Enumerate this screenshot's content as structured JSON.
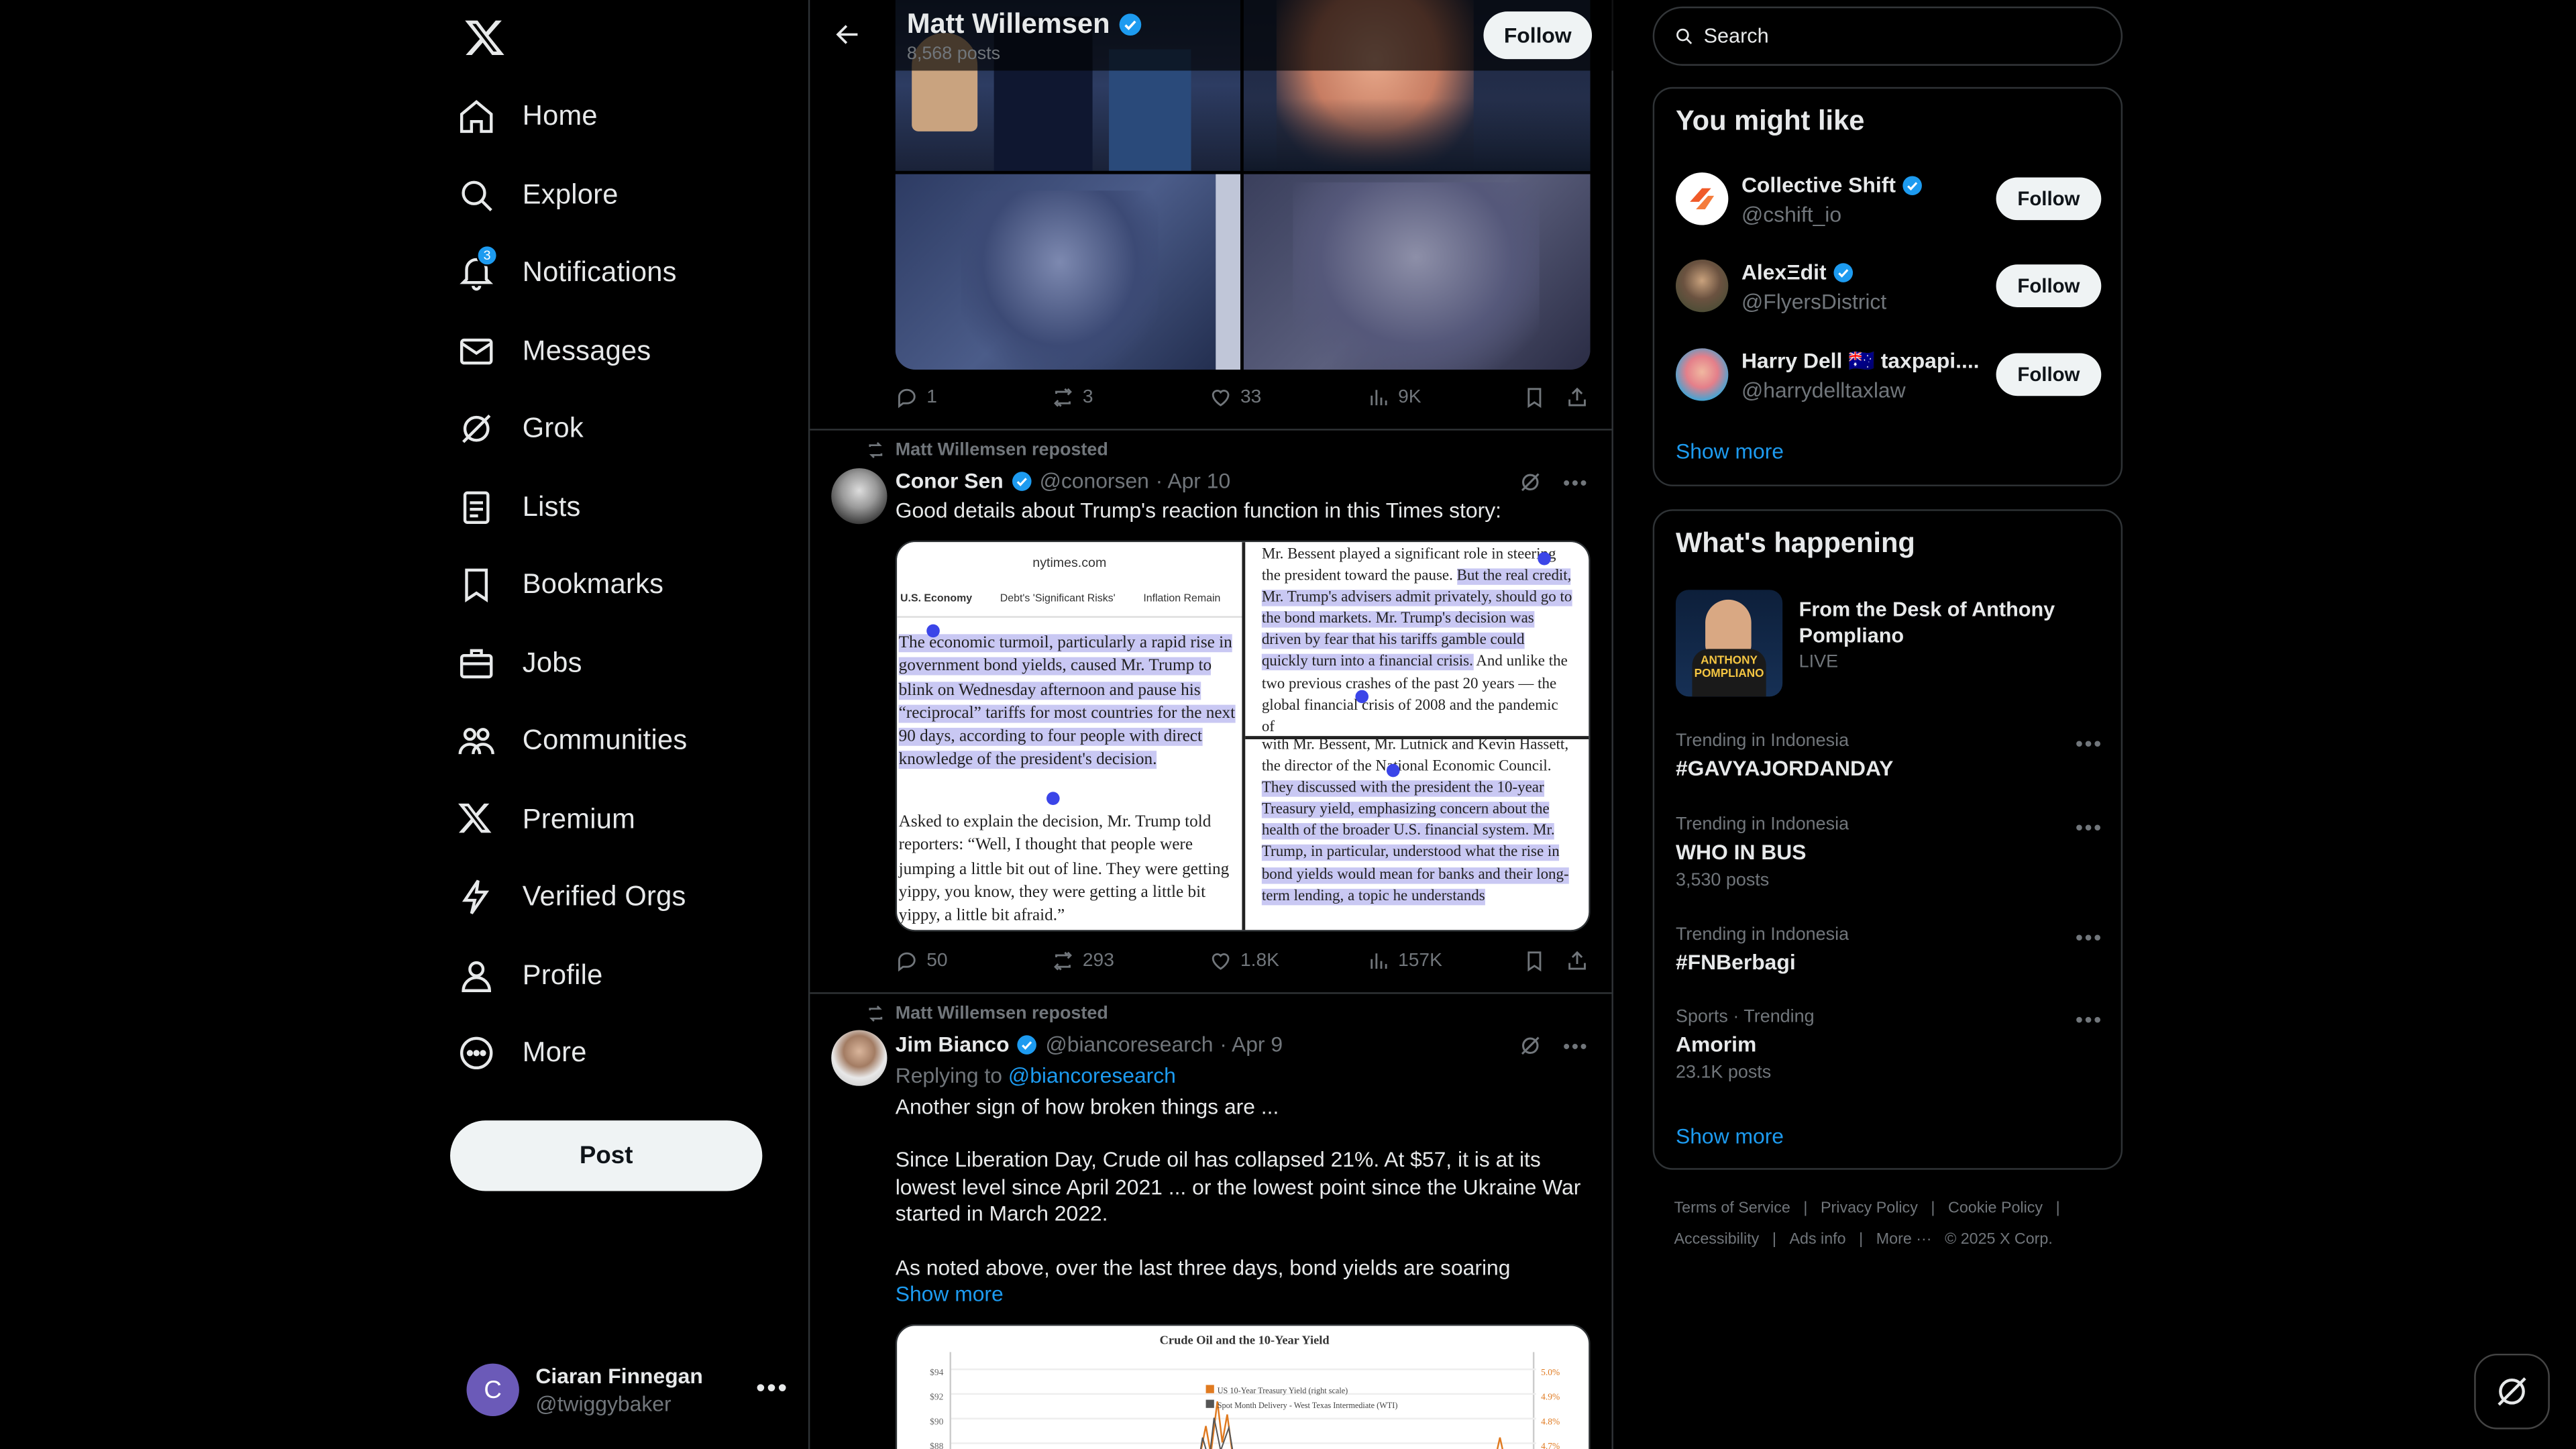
{
  "nav": {
    "items": [
      {
        "label": "Home",
        "icon": "home-icon"
      },
      {
        "label": "Explore",
        "icon": "search-icon"
      },
      {
        "label": "Notifications",
        "icon": "bell-icon",
        "badge": "3"
      },
      {
        "label": "Messages",
        "icon": "envelope-icon"
      },
      {
        "label": "Grok",
        "icon": "grok-icon"
      },
      {
        "label": "Lists",
        "icon": "list-icon"
      },
      {
        "label": "Bookmarks",
        "icon": "bookmark-icon"
      },
      {
        "label": "Jobs",
        "icon": "briefcase-icon"
      },
      {
        "label": "Communities",
        "icon": "people-icon"
      },
      {
        "label": "Premium",
        "icon": "x-logo-icon"
      },
      {
        "label": "Verified Orgs",
        "icon": "lightning-icon"
      },
      {
        "label": "Profile",
        "icon": "person-icon"
      },
      {
        "label": "More",
        "icon": "more-circle-icon"
      }
    ],
    "post_label": "Post"
  },
  "account": {
    "initial": "C",
    "name": "Ciaran Finnegan",
    "handle": "@twiggybaker"
  },
  "header": {
    "name": "Matt Willemsen",
    "posts": "8,568 posts",
    "follow": "Follow"
  },
  "tweet1": {
    "replies": "1",
    "reposts": "3",
    "likes": "33",
    "views": "9K"
  },
  "tweet2": {
    "repost_by": "Matt Willemsen reposted",
    "name": "Conor Sen",
    "handle": "@conorsen",
    "date": "· Apr 10",
    "text": "Good details about Trump's reaction function in this Times story:",
    "replies": "50",
    "reposts": "293",
    "likes": "1.8K",
    "views": "157K",
    "news": {
      "site": "nytimes.com",
      "tabs": [
        "U.S. Economy",
        "Debt's 'Significant Risks'",
        "Inflation Remain"
      ],
      "left_hl": "The economic turmoil, particularly a rapid rise in government bond yields, caused Mr. Trump to blink on Wednesday afternoon and pause his “reciprocal” tariffs for most countries for the next 90 days, according to four people with direct knowledge of the president's decision.",
      "left_plain": "Asked to explain the decision, Mr. Trump told reporters: “Well, I thought that people were jumping a little bit out of line. They were getting yippy, you know, they were getting a little bit yippy, a little bit afraid.”",
      "right_top_a": "Mr. Bessent played a significant role in steering the president toward the pause.",
      "right_top_b": "But the real credit, Mr. Trump's advisers admit privately, should go to the bond markets. Mr. Trump's decision was driven by fear that his tariffs gamble could quickly turn into a financial crisis.",
      "right_top_c": "And unlike the two previous crashes of the past 20 years — the global financial crisis of 2008 and the pandemic of",
      "right_bot_a": "with Mr. Bessent, Mr. Lutnick and Kevin Hassett, the director of the National Economic Council.",
      "right_bot_b": "They discussed with the president the 10-year Treasury yield, emphasizing concern about the health of the broader U.S. financial system. Mr. Trump, in particular, understood what the rise in bond yields would mean for banks and their long-term lending, a topic he understands"
    }
  },
  "tweet3": {
    "repost_by": "Matt Willemsen reposted",
    "name": "Jim Bianco",
    "handle": "@biancoresearch",
    "date": "· Apr 9",
    "replying_label": "Replying to",
    "replying_to": "@biancoresearch",
    "p1": "Another sign of how broken things are ...",
    "p2": "Since Liberation Day, Crude oil has collapsed 21%. At $57, it is at its lowest level since April 2021 ... or the lowest point since the Ukraine War started in March 2022.",
    "p3": "As noted above, over the last three days, bond yields are soaring",
    "show_more": "Show more",
    "chart": {
      "title": "Crude Oil and the 10-Year Yield",
      "legend": [
        "US 10-Year Treasury Yield (right scale)",
        "Spot Month Delivery - West Texas Intermediate (WTI)"
      ],
      "left_ticks": [
        "$94",
        "$92",
        "$90",
        "$88"
      ],
      "right_ticks": [
        "5.0%",
        "4.9%",
        "4.8%",
        "4.7%"
      ]
    }
  },
  "search": {
    "placeholder": "Search"
  },
  "you_might_like": {
    "title": "You might like",
    "users": [
      {
        "name": "Collective Shift",
        "handle": "@cshift_io",
        "verified": true
      },
      {
        "name": "AlexΞdit",
        "handle": "@FlyersDistrict",
        "verified": true
      },
      {
        "name": "Harry Dell 🇦🇺 taxpapi....",
        "handle": "@harrydelltaxlaw",
        "verified": false
      }
    ],
    "follow": "Follow",
    "show_more": "Show more"
  },
  "whats_happening": {
    "title": "What's happening",
    "featured": {
      "title": "From the Desk of Anthony Pompliano",
      "status": "LIVE",
      "thumb_text": "ANTHONY POMPLIANO"
    },
    "trends": [
      {
        "context": "Trending in Indonesia",
        "title": "#GAVYAJORDANDAY",
        "count": ""
      },
      {
        "context": "Trending in Indonesia",
        "title": "WHO IN BUS",
        "count": "3,530 posts"
      },
      {
        "context": "Trending in Indonesia",
        "title": "#FNBerbagi",
        "count": ""
      },
      {
        "context": "Sports · Trending",
        "title": "Amorim",
        "count": "23.1K posts"
      }
    ],
    "show_more": "Show more"
  },
  "footer": {
    "row1": [
      "Terms of Service",
      "Privacy Policy",
      "Cookie Policy"
    ],
    "row2": [
      "Accessibility",
      "Ads info",
      "More ···",
      "© 2025 X Corp."
    ]
  }
}
